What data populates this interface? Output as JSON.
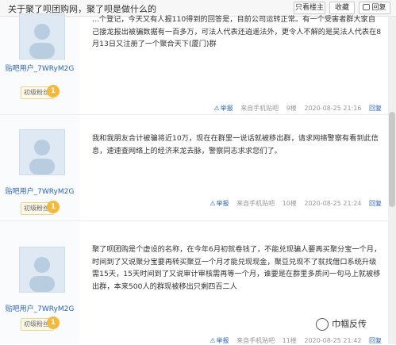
{
  "header": {
    "title": "关于聚了呗团购网，聚了呗是做什么的",
    "buttons": {
      "author_only": "只看楼主",
      "favorite": "收藏",
      "reply": "回复",
      "reply_icon": "speech-bubble-icon"
    }
  },
  "posts": [
    {
      "username": "贴吧用户_7WRyM2G",
      "badge": "初级粉丝",
      "level": "1",
      "content": "...个登记，今天又有人报110得到的回答是，目前公司运转正常。有一个受害者群大家自己接龙报出被骗数据有一百多万，可法人代表还逍遥法外，更令人不解的是吴法人代表在8月13日又注册了一个聚合天下(厦门)群",
      "report": "举报",
      "source": "来自手机贴吧",
      "floor": "9楼",
      "time": "2020-08-25 21:16",
      "reply": "回复"
    },
    {
      "username": "贴吧用户_7WRyM2G",
      "badge": "初级粉丝",
      "level": "1",
      "content": "我和我朋友合计被骗将近10万，现在在群里一说话就被移出群，请求网络警察有看到此信息，速速查网络上的经济来龙去脉，警察同志求求您们了。",
      "report": "举报",
      "source": "来自手机贴吧",
      "floor": "10楼",
      "time": "2020-08-25 21:24",
      "reply": "回复"
    },
    {
      "username": "贴吧用户_7WRyM2G",
      "badge": "初级粉丝",
      "level": "1",
      "content": "聚了呗团购是个虚设的名称，在今年6月初就卷钱了，不能兑现骗人要再买聚分宝一个月，时间到了又说聚分宝要再转买聚豆一个月才能兑现现金，聚豆兑现不了就找借口系统升级需15天，15天时间到了又说审计审核需再等一个月，谁要是在群里多质问一句马上就被移出群，本来500人的群现被移出只剩四百二人",
      "report": "举报",
      "source": "来自手机贴吧",
      "floor": "11楼",
      "time": "2020-08-25 21:42",
      "reply": "回复"
    }
  ],
  "watermark": {
    "text": "巾帼反传",
    "icon": "wechat-official-account-icon"
  }
}
